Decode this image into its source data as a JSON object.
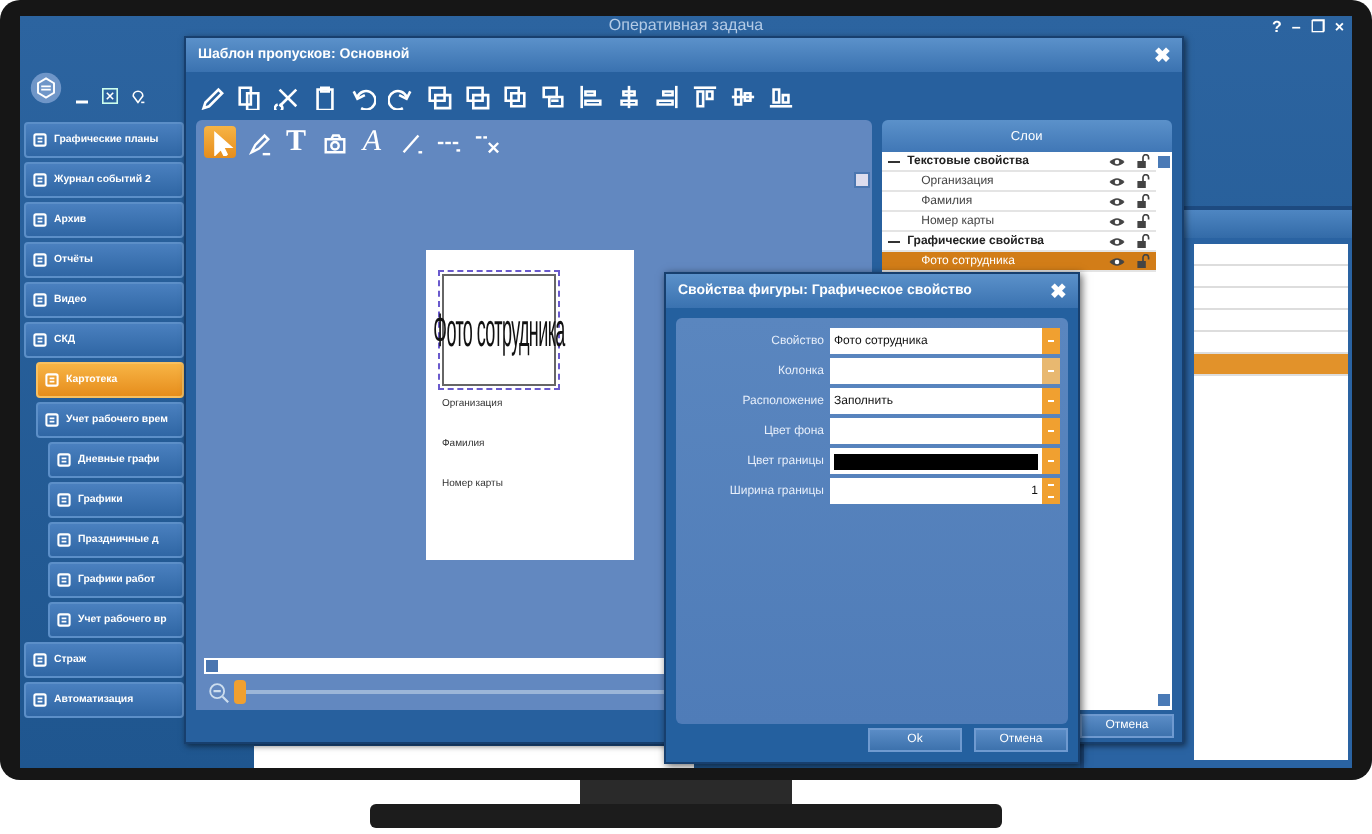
{
  "app": {
    "title": "Оперативная задача",
    "controls": [
      "?",
      "–",
      "❐",
      "×"
    ]
  },
  "sidebar": {
    "items": [
      {
        "label": "Графические планы",
        "selected": false
      },
      {
        "label": "Журнал событий 2",
        "selected": false
      },
      {
        "label": "Архив",
        "selected": false
      },
      {
        "label": "Отчёты",
        "selected": false
      },
      {
        "label": "Видео",
        "selected": false
      },
      {
        "label": "СКД",
        "selected": false,
        "children": [
          {
            "label": "Картотека",
            "selected": true
          },
          {
            "label": "Учет рабочего врем",
            "selected": false,
            "children": [
              {
                "label": "Дневные графи",
                "selected": false
              },
              {
                "label": "Графики",
                "selected": false
              },
              {
                "label": "Праздничные д",
                "selected": false
              },
              {
                "label": "Графики работ",
                "selected": false
              },
              {
                "label": "Учет рабочего вр",
                "selected": false
              }
            ]
          }
        ]
      },
      {
        "label": "Страж",
        "selected": false
      },
      {
        "label": "Автоматизация",
        "selected": false
      }
    ]
  },
  "template_window": {
    "title": "Шаблон пропусков: Основной",
    "close": "✖",
    "toolbar": [
      {
        "kind": "pencil"
      },
      {
        "kind": "copy"
      },
      {
        "kind": "cut"
      },
      {
        "kind": "paste"
      },
      {
        "kind": "undo"
      },
      {
        "kind": "redo"
      },
      {
        "kind": "front"
      },
      {
        "kind": "back"
      },
      {
        "kind": "forward"
      },
      {
        "kind": "backward"
      },
      {
        "kind": "align-left"
      },
      {
        "kind": "align-center"
      },
      {
        "kind": "align-right"
      },
      {
        "kind": "align-top"
      },
      {
        "kind": "align-middle"
      },
      {
        "kind": "align-bottom"
      }
    ],
    "tools": [
      {
        "kind": "pointer",
        "selected": true
      },
      {
        "kind": "pen",
        "selected": false
      },
      {
        "kind": "glyph",
        "glyph": "T",
        "selected": false
      },
      {
        "kind": "camera",
        "selected": false
      },
      {
        "kind": "glyph-italic",
        "glyph": "A",
        "selected": false
      },
      {
        "kind": "line",
        "selected": false
      },
      {
        "kind": "dash",
        "selected": false
      },
      {
        "kind": "delete",
        "selected": false
      }
    ],
    "card": {
      "photo": "Фото сотрудника",
      "fields": [
        "Организация",
        "Фамилия",
        "Номер карты"
      ]
    },
    "zoom": {
      "level": 0.0
    },
    "layers": {
      "title": "Слои",
      "groups": [
        {
          "label": "Текстовые свойства",
          "expanded": true,
          "children": [
            {
              "label": "Организация",
              "selected": false
            },
            {
              "label": "Фамилия",
              "selected": false
            },
            {
              "label": "Номер карты",
              "selected": false
            }
          ]
        },
        {
          "label": "Графические свойства",
          "expanded": true,
          "children": [
            {
              "label": "Фото сотрудника",
              "selected": true
            }
          ]
        }
      ]
    },
    "buttons": [
      "Отмена"
    ]
  },
  "dialog": {
    "title": "Свойства фигуры: Графическое свойство",
    "close": "✖",
    "fields": [
      {
        "label": "Свойство",
        "kind": "select",
        "value": "Фото сотрудника",
        "disabled": false
      },
      {
        "label": "Колонка",
        "kind": "select",
        "disabled": true
      },
      {
        "label": "Расположение",
        "kind": "select",
        "value": "Заполнить",
        "disabled": false
      },
      {
        "label": "Цвет фона",
        "kind": "color",
        "disabled": false
      },
      {
        "label": "Цвет границы",
        "kind": "color",
        "color": "#000000",
        "disabled": false
      },
      {
        "label": "Ширина границы",
        "kind": "number",
        "value": "1",
        "disabled": false
      }
    ],
    "buttons": [
      "Ok",
      "Отмена"
    ]
  }
}
